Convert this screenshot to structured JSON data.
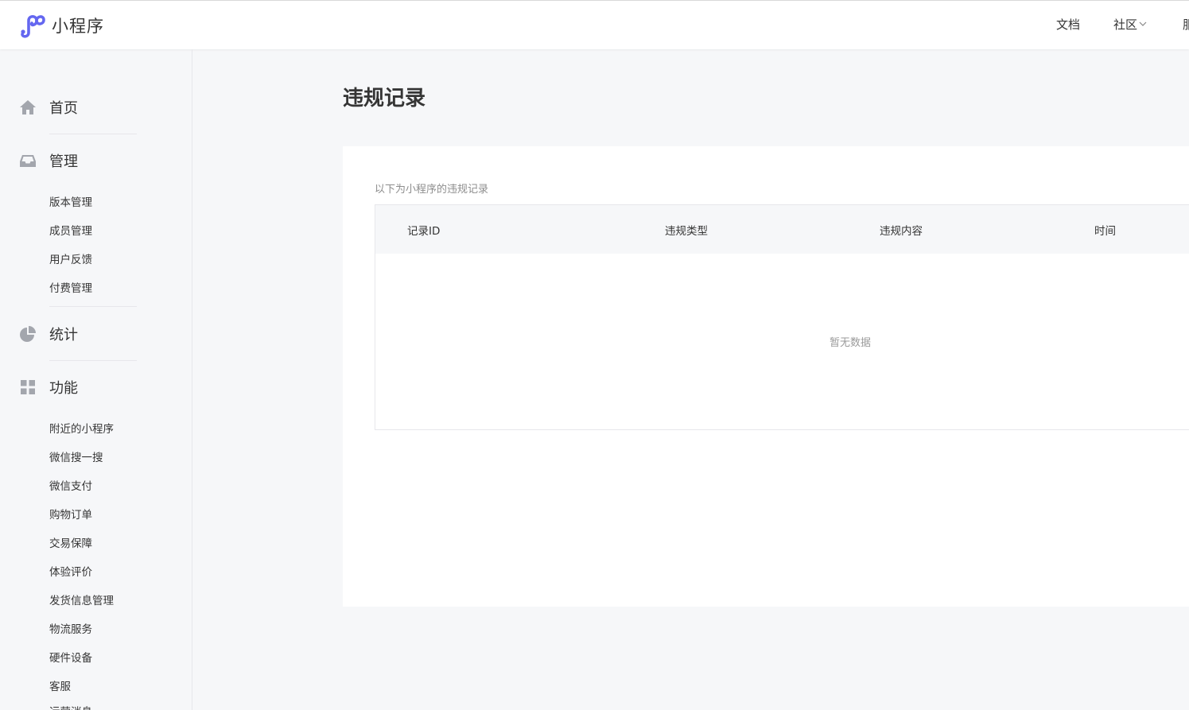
{
  "header": {
    "app_name": "小程序",
    "nav": {
      "docs": "文档",
      "community": "社区",
      "overflow": "服"
    }
  },
  "sidebar": {
    "home": "首页",
    "manage": {
      "label": "管理",
      "items": [
        "版本管理",
        "成员管理",
        "用户反馈",
        "付费管理"
      ]
    },
    "stats": "统计",
    "features": {
      "label": "功能",
      "items": [
        "附近的小程序",
        "微信搜一搜",
        "微信支付",
        "购物订单",
        "交易保障",
        "体验评价",
        "发货信息管理",
        "物流服务",
        "硬件设备",
        "客服",
        "运营消息"
      ]
    }
  },
  "main": {
    "title": "违规记录",
    "description": "以下为小程序的违规记录",
    "table": {
      "columns": [
        "记录ID",
        "违规类型",
        "违规内容",
        "时间"
      ],
      "empty_text": "暂无数据"
    }
  },
  "colors": {
    "logo": "#6467f0",
    "background": "#f6f7f9",
    "icon": "#a3a6ad"
  }
}
